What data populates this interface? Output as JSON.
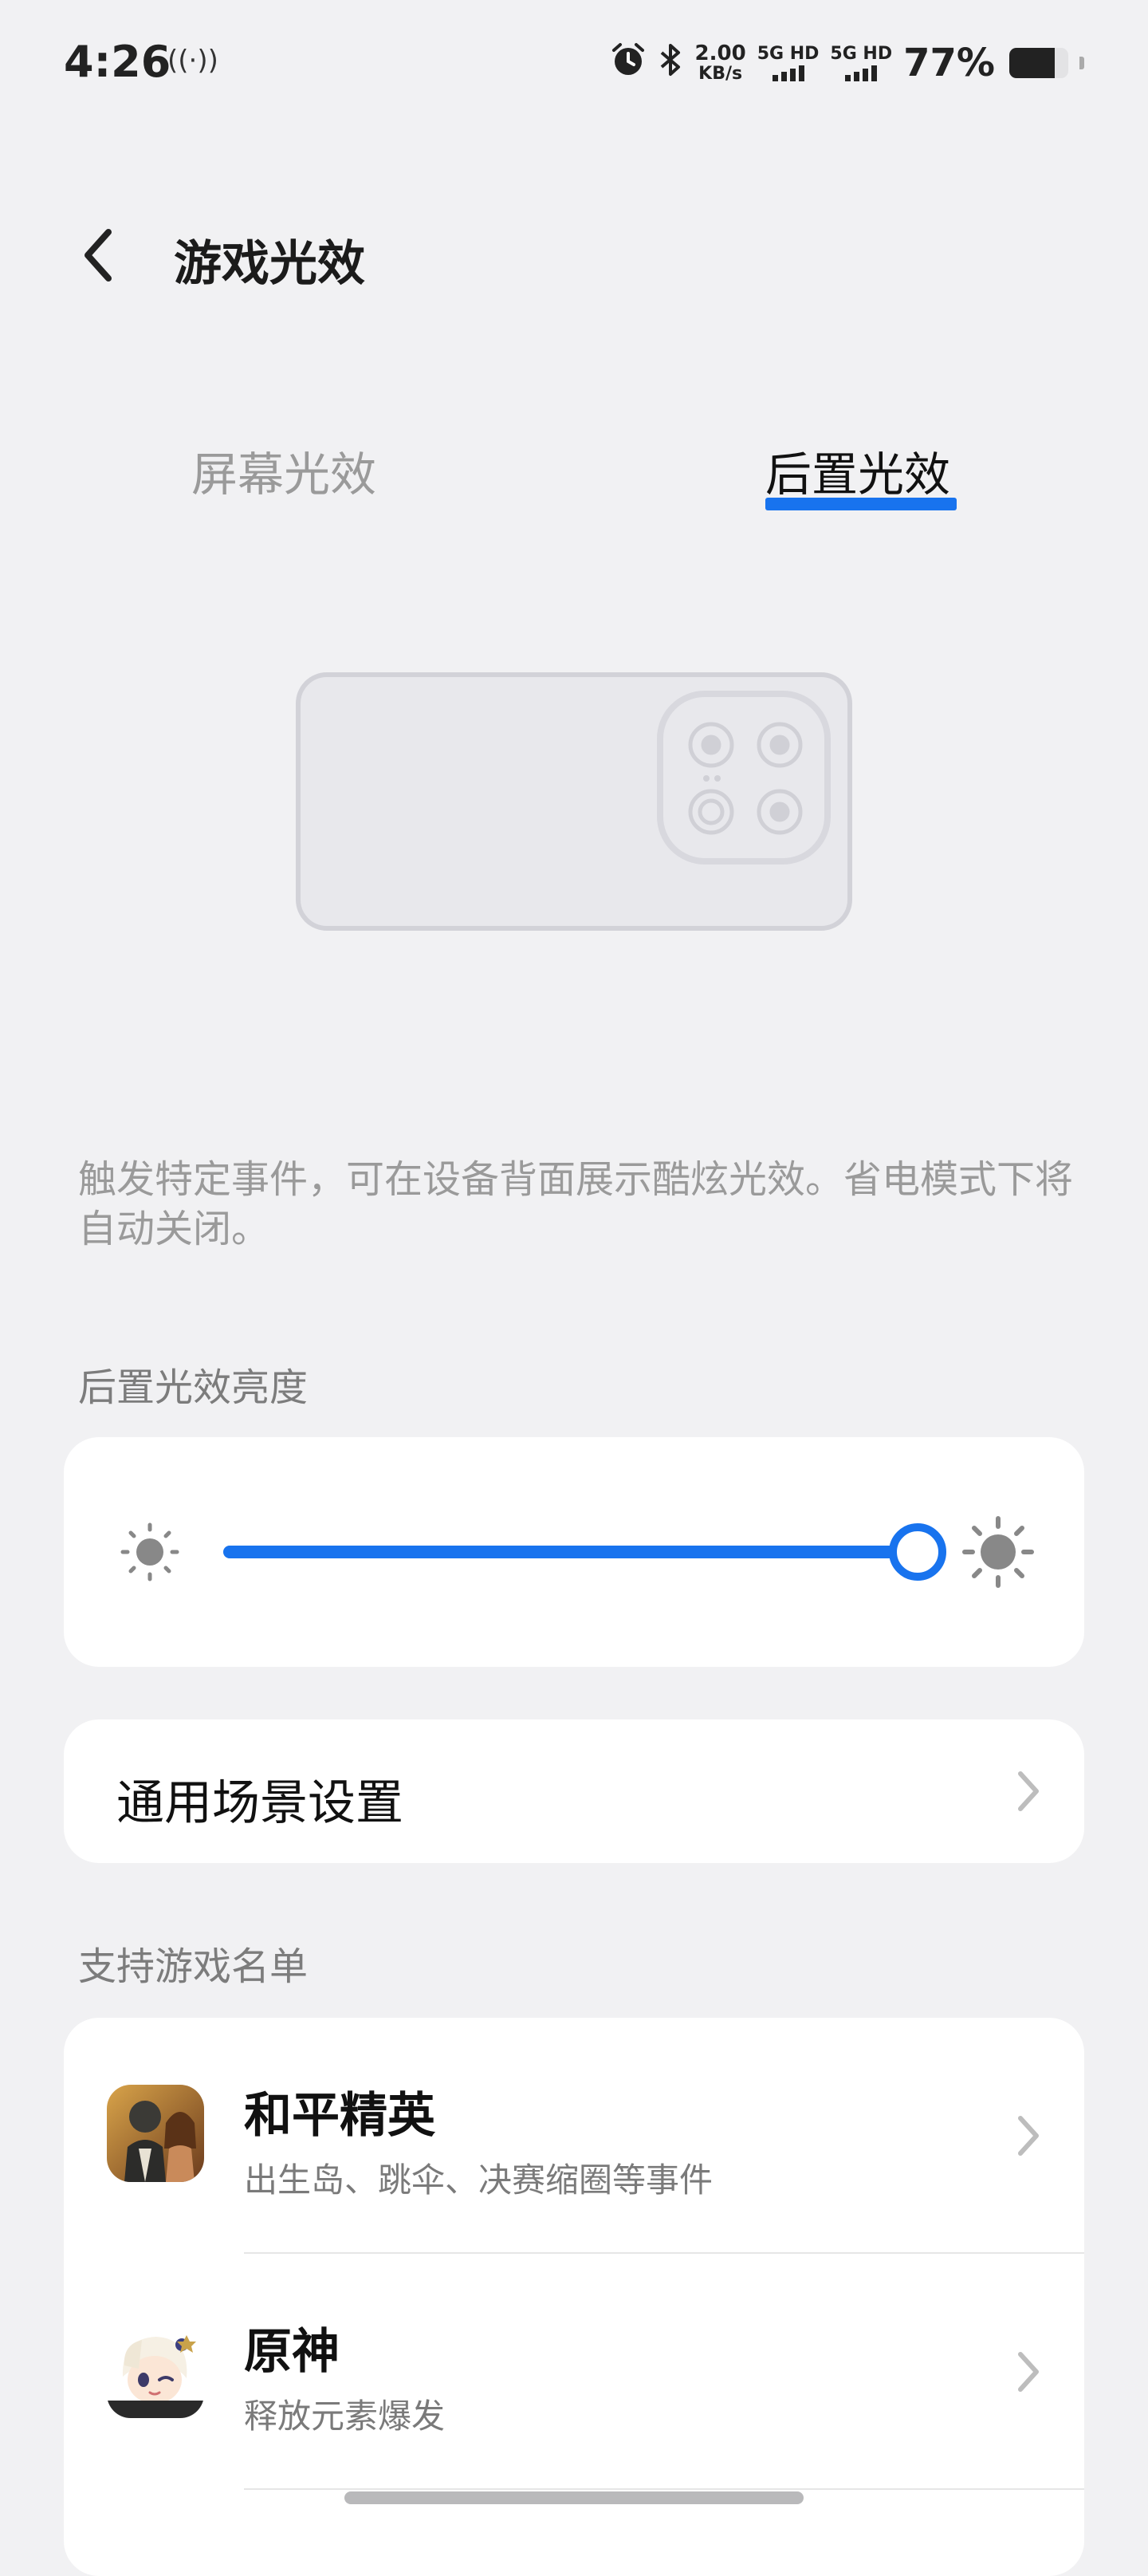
{
  "status_bar": {
    "time": "4:26",
    "hotspot_icon": "((·))",
    "net_speed_value": "2.00",
    "net_speed_unit": "KB/s",
    "sim1_label": "5G HD",
    "sim2_label": "5G HD",
    "battery_percent": "77%",
    "battery_level": 0.77
  },
  "header": {
    "title": "游戏光效"
  },
  "tabs": [
    {
      "label": "屏幕光效",
      "selected": false
    },
    {
      "label": "后置光效",
      "selected": true
    }
  ],
  "description": "触发特定事件，可在设备背面展示酷炫光效。省电模式下将自动关闭。",
  "brightness": {
    "section_label": "后置光效亮度",
    "value_fraction": 0.99
  },
  "general_scene": {
    "label": "通用场景设置"
  },
  "game_list": {
    "section_label": "支持游戏名单",
    "items": [
      {
        "name": "和平精英",
        "desc": "出生岛、跳伞、决赛缩圈等事件"
      },
      {
        "name": "原神",
        "desc": "释放元素爆发"
      }
    ]
  },
  "colors": {
    "accent": "#1873ee",
    "background": "#f1f1f3",
    "card": "#ffffff"
  }
}
